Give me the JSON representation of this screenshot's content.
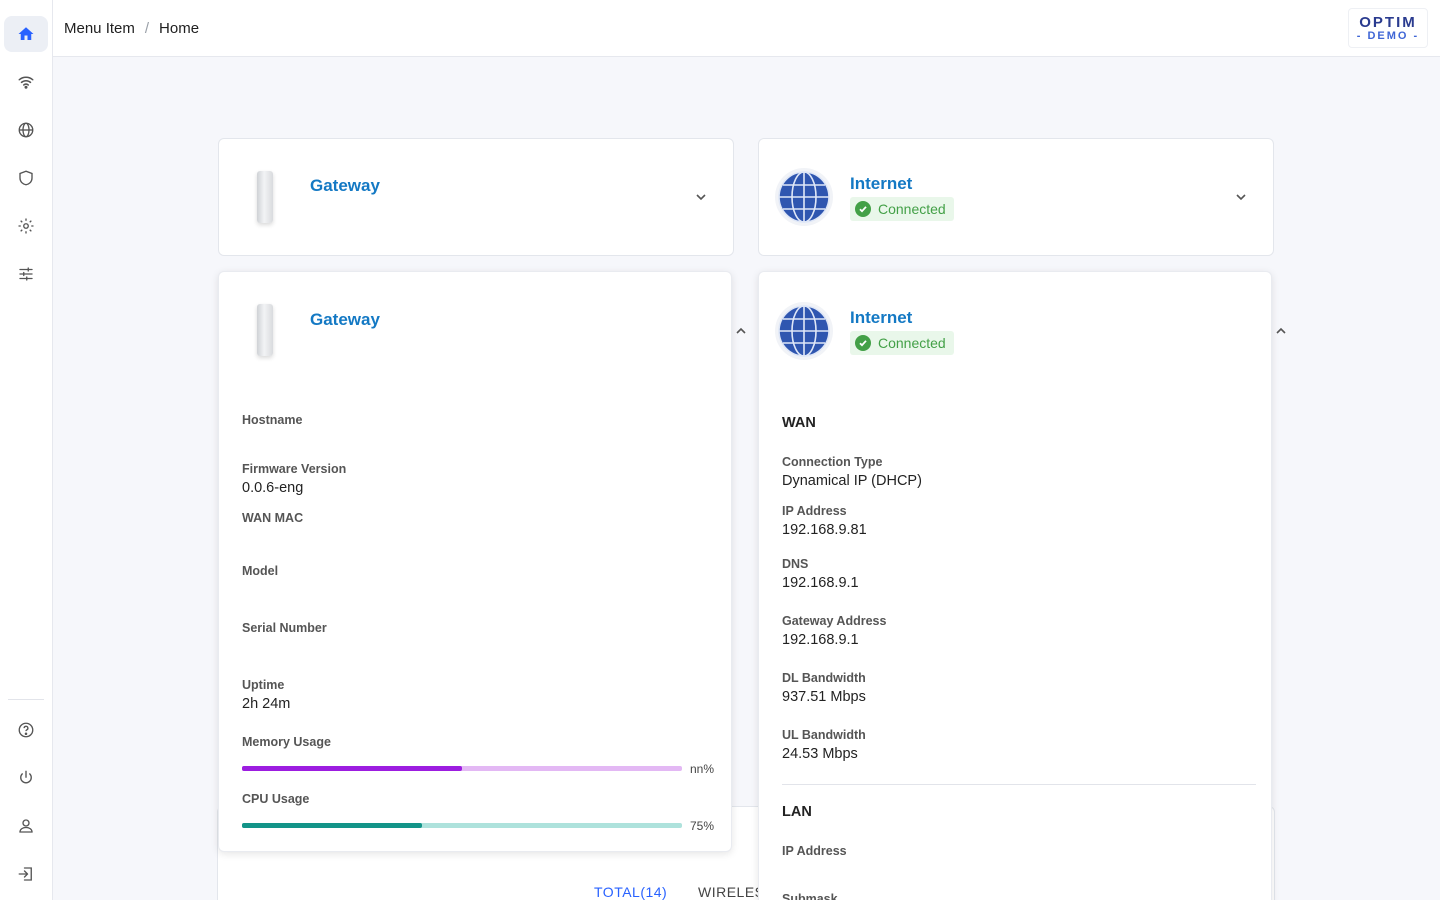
{
  "sidebar": {
    "top_items": [
      "home-icon",
      "wifi-icon",
      "globe-icon",
      "shield-icon",
      "gear-icon",
      "sliders-icon"
    ],
    "bottom_items": [
      "help-icon",
      "power-icon",
      "user-icon",
      "logout-icon"
    ]
  },
  "breadcrumb": {
    "item1": "Menu Item",
    "separator": "/",
    "item2": "Home"
  },
  "logo": {
    "main": "OPTIM",
    "sub": "- DEMO -"
  },
  "gateway_collapsed": {
    "title": "Gateway"
  },
  "internet_collapsed": {
    "title": "Internet",
    "status": "Connected"
  },
  "gateway_expanded": {
    "title": "Gateway",
    "fields": {
      "hostname_label": "Hostname",
      "firmware_label": "Firmware Version",
      "firmware_value": "0.0.6-eng",
      "wanmac_label": "WAN MAC",
      "model_label": "Model",
      "serial_label": "Serial Number",
      "uptime_label": "Uptime",
      "uptime_value": "2h 24m"
    },
    "memory": {
      "label": "Memory Usage",
      "percent_text": "nn%",
      "fill": 0.5,
      "color": "#9c1de0",
      "track": "#e3b8f4"
    },
    "cpu": {
      "label": "CPU Usage",
      "percent_text": "75%",
      "fill": 0.41,
      "color": "#139488",
      "track": "#aee2dc"
    }
  },
  "internet_expanded": {
    "title": "Internet",
    "status": "Connected",
    "wan": {
      "section": "WAN",
      "conn_type_label": "Connection Type",
      "conn_type_value": "Dynamical IP (DHCP)",
      "ip_label": "IP Address",
      "ip_value": "192.168.9.81",
      "dns_label": "DNS",
      "dns_value": "192.168.9.1",
      "gw_label": "Gateway Address",
      "gw_value": "192.168.9.1",
      "dl_label": "DL Bandwidth",
      "dl_value": "937.51 Mbps",
      "ul_label": "UL Bandwidth",
      "ul_value": "24.53 Mbps"
    },
    "lan": {
      "section": "LAN",
      "ip_label": "IP Address",
      "submask_label": "Submask"
    }
  },
  "devices_tabs": {
    "total": "TOTAL(14)",
    "wireless": "WIRELES"
  },
  "colors": {
    "accent": "#1479c4",
    "connected": "#43a047",
    "active_nav": "#2962ff"
  }
}
